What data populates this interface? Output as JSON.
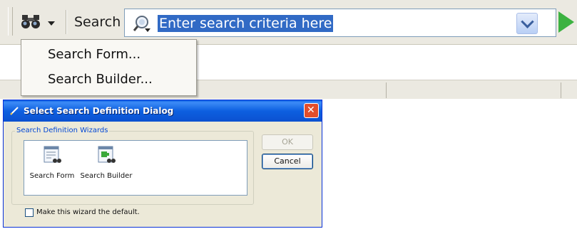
{
  "toolbar": {
    "search_label": "Search",
    "search_text": "Enter search criteria here",
    "icons": [
      "binoculars-icon",
      "dropdown-caret-icon",
      "magnifier-icon",
      "combo-arrow-icon",
      "go-arrow-icon"
    ],
    "go_color": "#3cb241",
    "selection_color": "#316ac5"
  },
  "menu": {
    "items": [
      "Search Form...",
      "Search Builder..."
    ]
  },
  "dialog": {
    "title": "Select Search Definition Dialog",
    "group_label": "Search Definition Wizards",
    "items": [
      "Search Form",
      "Search Builder"
    ],
    "ok_label": "OK",
    "cancel_label": "Cancel",
    "checkbox_label": "Make this wizard the default.",
    "checkbox_checked": false,
    "titlebar_color": "#0b51d0"
  }
}
